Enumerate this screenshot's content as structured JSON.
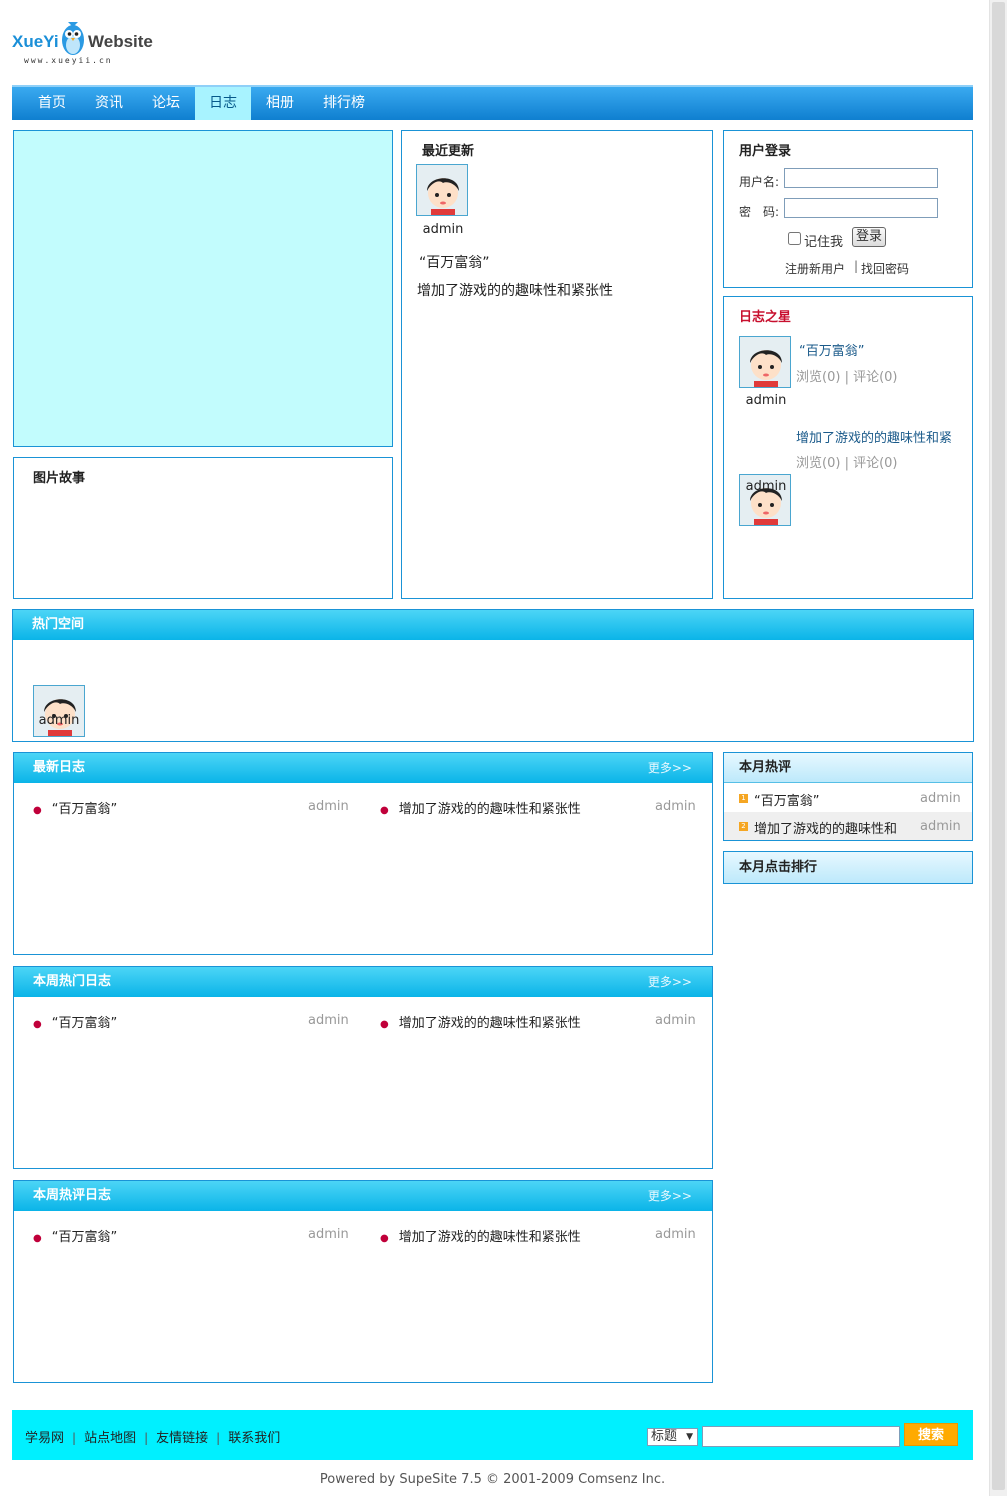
{
  "logo": {
    "name_left": "XueYi",
    "name_right": "Website",
    "url": "www.xueyii.cn"
  },
  "nav": [
    "首页",
    "资讯",
    "论坛",
    "日志",
    "相册",
    "排行榜"
  ],
  "nav_active_index": 3,
  "picture_story": {
    "title": "图片故事"
  },
  "recent": {
    "title": "最近更新",
    "user": "admin",
    "entries": [
      "“百万富翁”",
      "增加了游戏的的趣味性和紧张性"
    ]
  },
  "login": {
    "title": "用户登录",
    "username_label": "用户名:",
    "password_label": "密　码:",
    "remember_label": "记住我",
    "login_button": "登录",
    "register_link": "注册新用户",
    "divider": "|",
    "forgot_link": "找回密码"
  },
  "star": {
    "title": "日志之星",
    "items": [
      {
        "title": "“百万富翁”",
        "views": "浏览(0)",
        "sep": "|",
        "comments": "评论(0)",
        "user": "admin"
      },
      {
        "title": "增加了游戏的的趣味性和紧",
        "views": "浏览(0)",
        "sep": "|",
        "comments": "评论(0)",
        "user": "admin"
      }
    ]
  },
  "hot_space": {
    "title": "热门空间",
    "user": "admin"
  },
  "more_label": "更多>>",
  "blog_lists": [
    {
      "title": "最新日志",
      "items": [
        {
          "text": "“百万富翁”",
          "user": "admin"
        },
        {
          "text": "增加了游戏的的趣味性和紧张性",
          "user": "admin"
        }
      ]
    },
    {
      "title": "本周热门日志",
      "items": [
        {
          "text": "“百万富翁”",
          "user": "admin"
        },
        {
          "text": "增加了游戏的的趣味性和紧张性",
          "user": "admin"
        }
      ]
    },
    {
      "title": "本周热评日志",
      "items": [
        {
          "text": "“百万富翁”",
          "user": "admin"
        },
        {
          "text": "增加了游戏的的趣味性和紧张性",
          "user": "admin"
        }
      ]
    }
  ],
  "month_hot": {
    "title": "本月热评",
    "items": [
      {
        "rank": "1",
        "text": "“百万富翁”",
        "user": "admin"
      },
      {
        "rank": "2",
        "text": "增加了游戏的的趣味性和",
        "user": "admin"
      }
    ]
  },
  "month_click": {
    "title": "本月点击排行"
  },
  "footer": {
    "links": [
      "学易网",
      "站点地图",
      "友情链接",
      "联系我们"
    ],
    "divider": "|",
    "search_select": "标题",
    "search_button": "搜索",
    "copyright": "Powered by SupeSite 7.5 © 2001-2009 Comsenz Inc."
  },
  "colors": {
    "nav": "#1a8fd8",
    "nav_active": "#a8f3ff",
    "border": "#1a93d6",
    "footer": "#00f0ff",
    "banner_placeholder": "#c2fcfd",
    "search_button": "#ffaa00"
  }
}
